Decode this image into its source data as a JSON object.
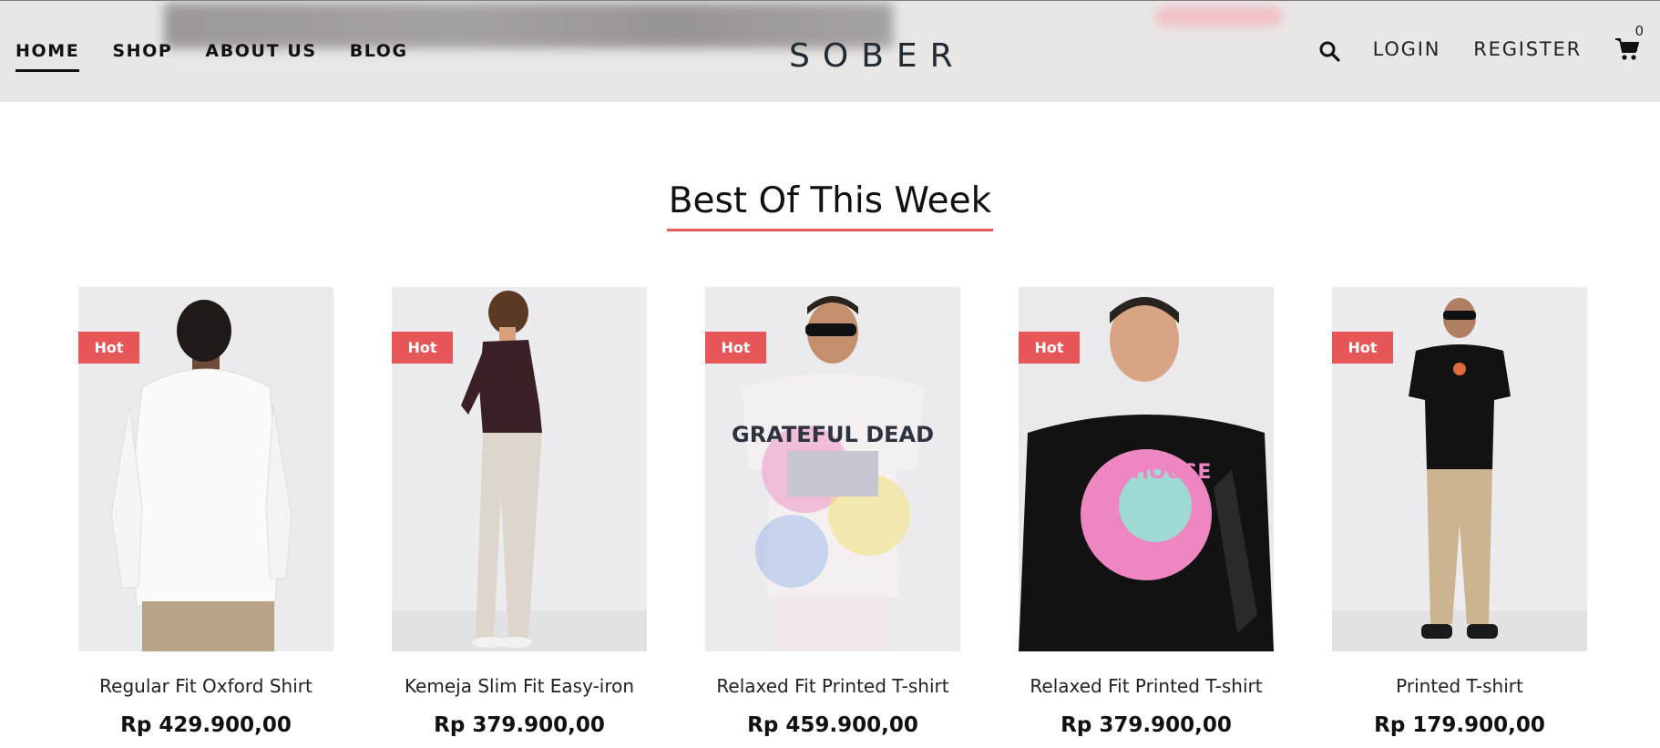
{
  "header": {
    "nav": [
      "HOME",
      "SHOP",
      "ABOUT US",
      "BLOG"
    ],
    "logo": "SOBER",
    "login": "LOGIN",
    "register": "REGISTER",
    "cart_count": "0"
  },
  "section": {
    "title": "Best Of This Week"
  },
  "products": [
    {
      "badge": "Hot",
      "name": "Regular Fit Oxford Shirt",
      "price": "Rp 429.900,00"
    },
    {
      "badge": "Hot",
      "name": "Kemeja Slim Fit Easy-iron",
      "price": "Rp 379.900,00"
    },
    {
      "badge": "Hot",
      "name": "Relaxed Fit Printed T-shirt",
      "price": "Rp 459.900,00"
    },
    {
      "badge": "Hot",
      "name": "Relaxed Fit Printed T-shirt",
      "price": "Rp 379.900,00"
    },
    {
      "badge": "Hot",
      "name": "Printed T-shirt",
      "price": "Rp 179.900,00"
    }
  ],
  "icons": {
    "search": "search-icon",
    "cart": "cart-icon"
  },
  "colors": {
    "accent": "#e85757",
    "header_bg": "#e9e6e6"
  }
}
